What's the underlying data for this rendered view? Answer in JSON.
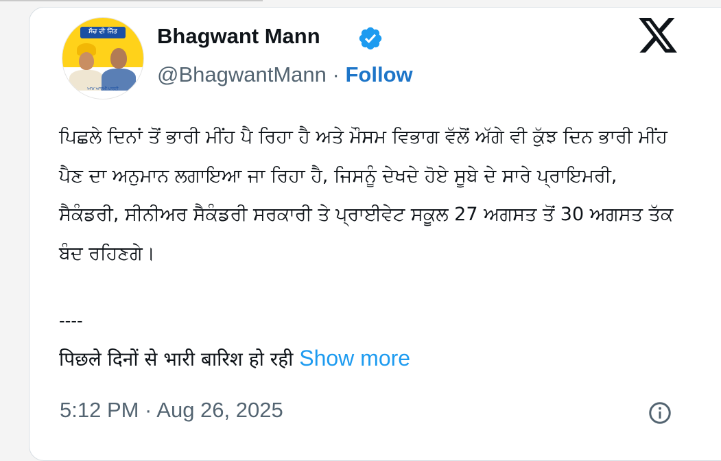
{
  "author": {
    "name": "Bhagwant Mann",
    "handle": "@BhagwantMann",
    "separator": "·",
    "follow_label": "Follow",
    "verified_icon": "verified-badge-icon",
    "avatar": {
      "slogan": "ਸੱਚ ਦੀ ਜਿੱਤ",
      "party": "ਆਮ ਆਦਮੀ ਪਾਰਟੀ"
    }
  },
  "platform_icon": "x-logo-icon",
  "post": {
    "body_punjabi": "ਪਿਛਲੇ ਦਿਨਾਂ ਤੋਂ ਭਾਰੀ ਮੀਂਹ ਪੈ ਰਿਹਾ ਹੈ ਅਤੇ ਮੌਸਮ ਵਿਭਾਗ ਵੱਲੋਂ ਅੱਗੇ ਵੀ ਕੁੱਝ ਦਿਨ ਭਾਰੀ ਮੀਂਹ ਪੈਣ ਦਾ ਅਨੁਮਾਨ ਲਗਾਇਆ ਜਾ ਰਿਹਾ ਹੈ, ਜਿਸਨੂੰ ਦੇਖਦੇ ਹੋਏ ਸੂਬੇ ਦੇ ਸਾਰੇ ਪ੍ਰਾਇਮਰੀ, ਸੈਕੰਡਰੀ, ਸੀਨੀਅਰ ਸੈਕੰਡਰੀ ਸਰਕਾਰੀ ਤੇ ਪ੍ਰਾਈਵੇਟ ਸਕੂਲ 27 ਅਗਸਤ ਤੋਂ 30 ਅਗਸਤ ਤੱਕ ਬੰਦ ਰਹਿਣਗੇ।",
    "divider": "----",
    "body_hindi_preview": "पिछले दिनों से भारी बारिश हो रही",
    "show_more_label": "Show more",
    "timestamp": "5:12 PM · Aug 26, 2025",
    "info_icon": "info-icon"
  },
  "colors": {
    "link": "#1d9bf0",
    "follow": "#1d75c8",
    "secondary_text": "#536471",
    "primary_text": "#0f1419",
    "verified": "#1d9bf0"
  }
}
